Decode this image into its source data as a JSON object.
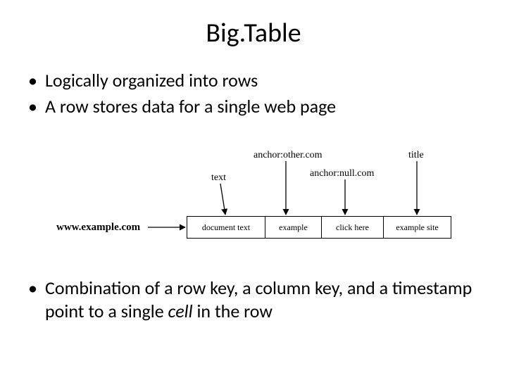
{
  "title": "Big.Table",
  "bullets_top": [
    "Logically organized into rows",
    "A row stores data for a single web page"
  ],
  "bullet_bottom_prefix": "Combination of a row key, a column key, and a timestamp point to a single ",
  "bullet_bottom_em": "cell",
  "bullet_bottom_suffix": " in the row",
  "diagram": {
    "row_key": "www.example.com",
    "columns": [
      {
        "name": "text",
        "value": "document text"
      },
      {
        "name": "anchor:other.com",
        "value": "example"
      },
      {
        "name": "anchor:null.com",
        "value": "click here"
      },
      {
        "name": "title",
        "value": "example site"
      }
    ]
  }
}
